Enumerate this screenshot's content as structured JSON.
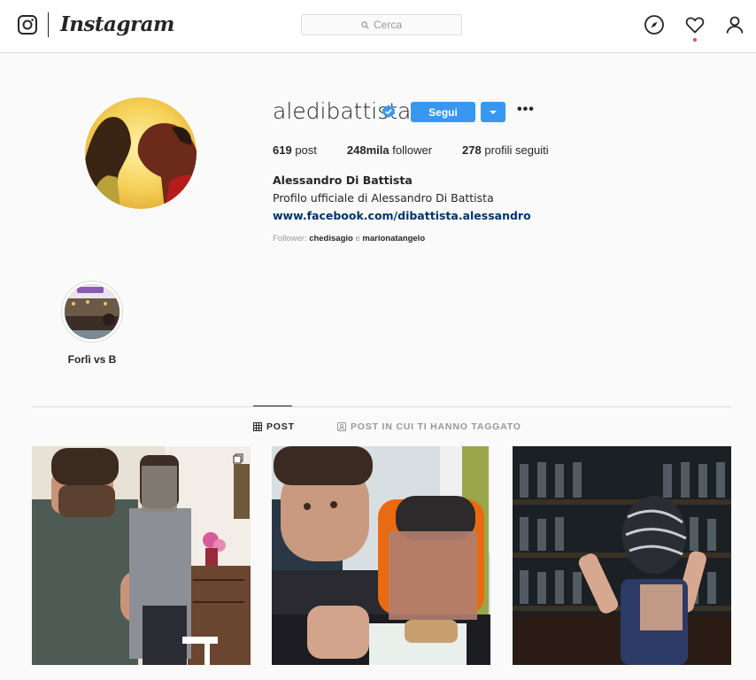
{
  "header": {
    "logo_text": "Instagram",
    "search_placeholder": "Cerca",
    "icons": [
      "instagram-camera-icon",
      "search-icon",
      "compass-icon",
      "heart-icon",
      "user-icon"
    ],
    "notification_color": "#ed4956"
  },
  "profile": {
    "username": "aledibattista",
    "verified": true,
    "follow_label": "Segui",
    "more_label": "•••",
    "stats": {
      "posts_count": "619",
      "posts_label": "post",
      "followers_count": "248mila",
      "followers_label": "follower",
      "following_count": "278",
      "following_label": "profili seguiti"
    },
    "full_name": "Alessandro Di Battista",
    "bio": "Profilo ufficiale di Alessandro Di Battista",
    "website": "www.facebook.com/dibattista.alessandro",
    "followed_by_prefix": "Follower:",
    "followed_by_user1": "chedisagio",
    "followed_by_and": "e",
    "followed_by_user2": "marionatangelo"
  },
  "highlights": [
    {
      "label": "Forlì vs B"
    }
  ],
  "tabs": {
    "post_label": "POST",
    "tagged_label": "POST IN CUI TI HANNO TAGGATO",
    "active": "POST"
  },
  "colors": {
    "accent": "#3897f0",
    "link": "#003569",
    "border": "#dbdbdb",
    "background": "#fafafa"
  }
}
